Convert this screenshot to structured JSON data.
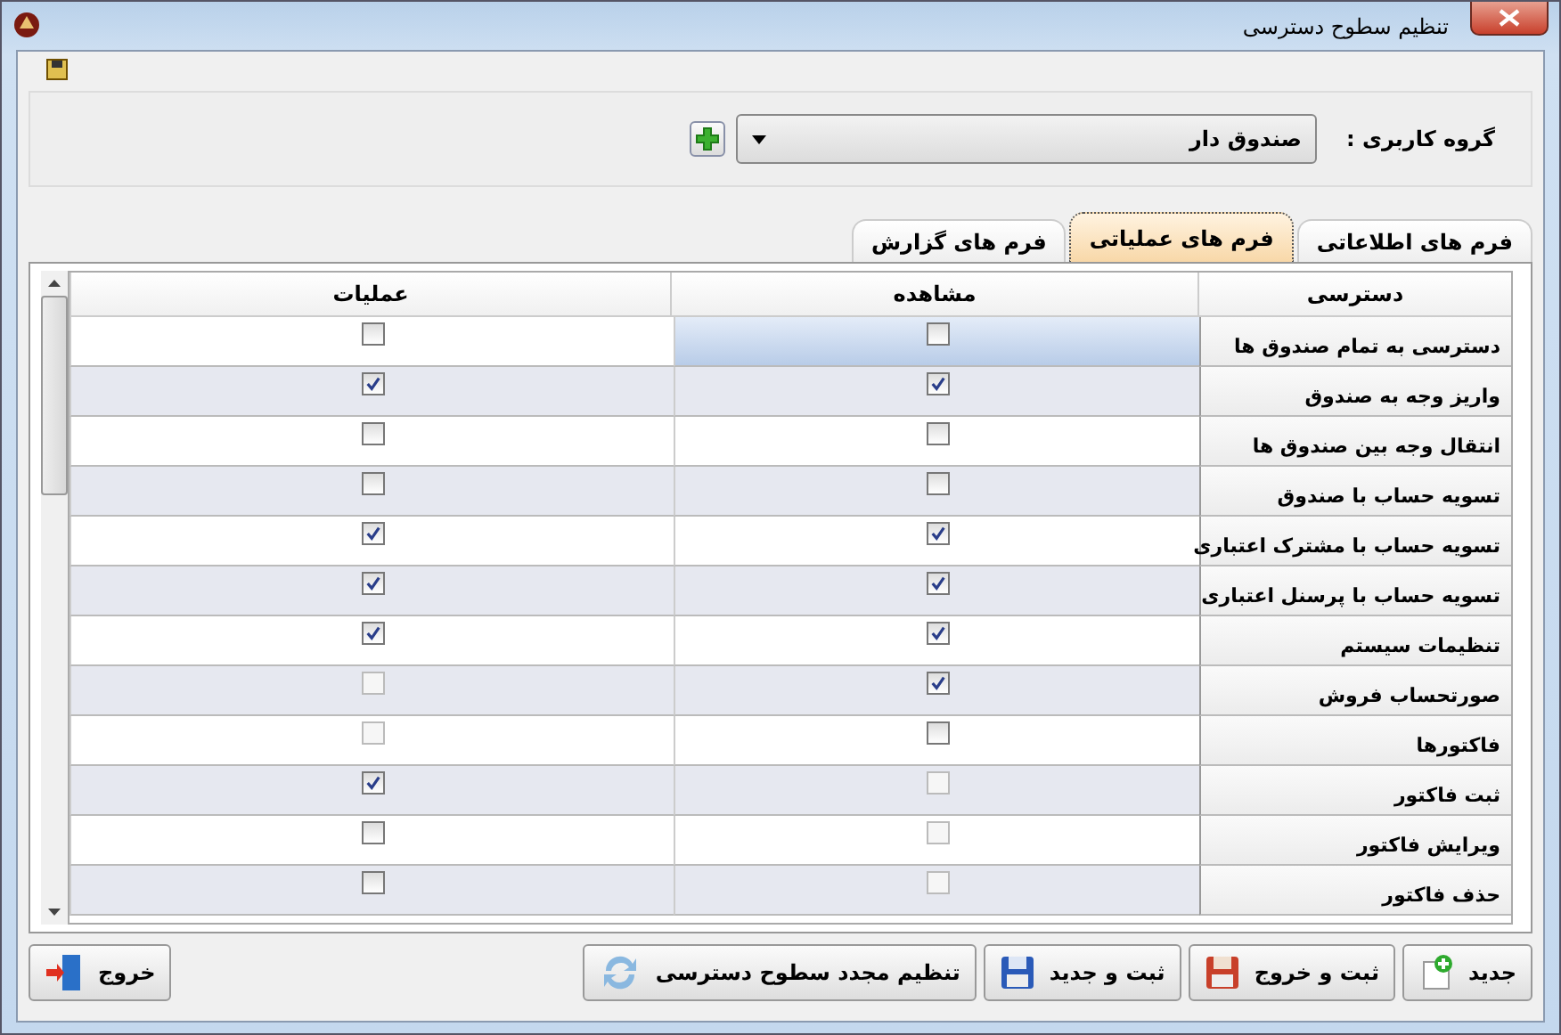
{
  "window": {
    "title": "تنظیم سطوح دسترسی"
  },
  "user_group": {
    "label": "گروه کاربری :",
    "value": "صندوق دار"
  },
  "tabs": [
    {
      "label": "فرم های اطلاعاتی",
      "selected": false
    },
    {
      "label": "فرم های عملیاتی",
      "selected": true
    },
    {
      "label": "فرم های گزارش",
      "selected": false
    }
  ],
  "table": {
    "columns": [
      "دسترسی",
      "مشاهده",
      "عملیات"
    ],
    "rows": [
      {
        "name": "دسترسی به تمام صندوق ها",
        "selected": true,
        "view": {
          "checked": false,
          "disabled": false
        },
        "operation": {
          "checked": false,
          "disabled": false
        }
      },
      {
        "name": "واریز وجه به صندوق",
        "selected": false,
        "view": {
          "checked": true,
          "disabled": false
        },
        "operation": {
          "checked": true,
          "disabled": false
        }
      },
      {
        "name": "انتقال وجه بین صندوق ها",
        "selected": false,
        "view": {
          "checked": false,
          "disabled": false
        },
        "operation": {
          "checked": false,
          "disabled": false
        }
      },
      {
        "name": "تسویه حساب با صندوق",
        "selected": false,
        "view": {
          "checked": false,
          "disabled": false
        },
        "operation": {
          "checked": false,
          "disabled": false
        }
      },
      {
        "name": "تسویه حساب با مشترک اعتباری",
        "selected": false,
        "view": {
          "checked": true,
          "disabled": false
        },
        "operation": {
          "checked": true,
          "disabled": false
        }
      },
      {
        "name": "تسویه حساب با پرسنل اعتباری",
        "selected": false,
        "view": {
          "checked": true,
          "disabled": false
        },
        "operation": {
          "checked": true,
          "disabled": false
        }
      },
      {
        "name": "تنظیمات سیستم",
        "selected": false,
        "view": {
          "checked": true,
          "disabled": false
        },
        "operation": {
          "checked": true,
          "disabled": false
        }
      },
      {
        "name": "صورتحساب فروش",
        "selected": false,
        "view": {
          "checked": true,
          "disabled": false
        },
        "operation": {
          "checked": false,
          "disabled": true
        }
      },
      {
        "name": "فاکتورها",
        "selected": false,
        "view": {
          "checked": false,
          "disabled": false
        },
        "operation": {
          "checked": false,
          "disabled": true
        }
      },
      {
        "name": "ثبت فاکتور",
        "selected": false,
        "view": {
          "checked": false,
          "disabled": true
        },
        "operation": {
          "checked": true,
          "disabled": false
        }
      },
      {
        "name": "ویرایش فاکتور",
        "selected": false,
        "view": {
          "checked": false,
          "disabled": true
        },
        "operation": {
          "checked": false,
          "disabled": false
        }
      },
      {
        "name": "حذف فاکتور",
        "selected": false,
        "view": {
          "checked": false,
          "disabled": true
        },
        "operation": {
          "checked": false,
          "disabled": false
        }
      }
    ]
  },
  "buttons": [
    {
      "kind": "new",
      "label": "جدید"
    },
    {
      "kind": "save-exit",
      "label": "ثبت و خروج"
    },
    {
      "kind": "save-new",
      "label": "ثبت و جدید"
    },
    {
      "kind": "reset",
      "label": "تنظیم مجدد سطوح دسترسی"
    },
    {
      "kind": "exit",
      "label": "خروج"
    }
  ]
}
